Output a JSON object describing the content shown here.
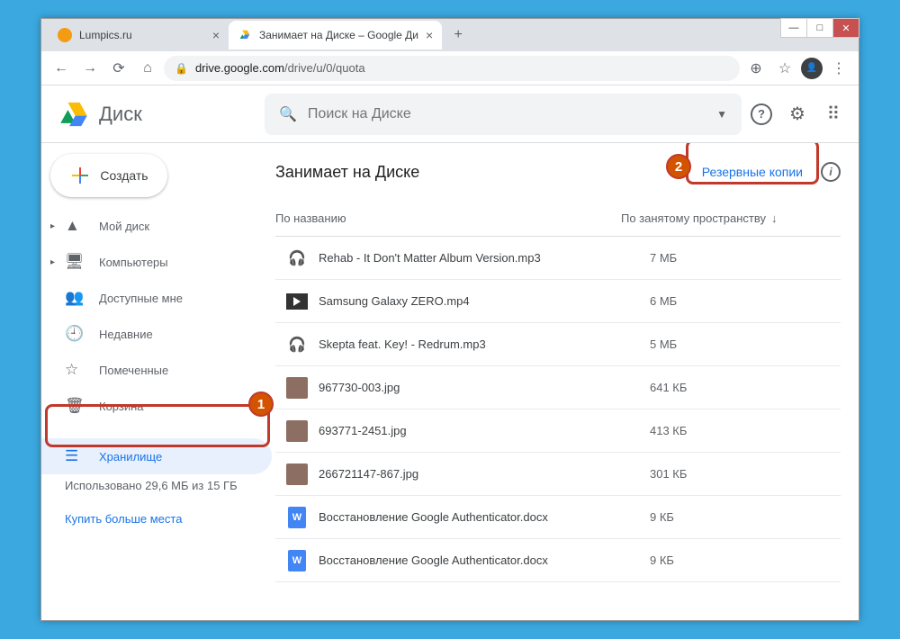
{
  "window": {
    "minimize": "—",
    "maximize": "□",
    "close": "✕"
  },
  "tabs": [
    {
      "title": "Lumpics.ru",
      "active": false,
      "favicon_color": "#f39c12"
    },
    {
      "title": "Занимает на Диске – Google Ди",
      "active": true,
      "favicon_color": "#0f9d58"
    }
  ],
  "newtab": "+",
  "nav": {
    "back": "←",
    "forward": "→",
    "reload": "⟳",
    "home": "⌂"
  },
  "address": {
    "lock": "🔒",
    "host": "drive.google.com",
    "path": "/drive/u/0/quota",
    "new_icon": "⊕",
    "star": "☆",
    "menu": "⋮"
  },
  "app": {
    "name": "Диск",
    "search_placeholder": "Поиск на Диске",
    "help": "?",
    "settings": "⚙",
    "apps": "⠿"
  },
  "create_label": "Создать",
  "sidebar": [
    {
      "icon": "▲",
      "label": "Мой диск",
      "expandable": true
    },
    {
      "icon": "🖥",
      "label": "Компьютеры",
      "expandable": true
    },
    {
      "icon": "👥",
      "label": "Доступные мне"
    },
    {
      "icon": "🕘",
      "label": "Недавние"
    },
    {
      "icon": "☆",
      "label": "Помеченные"
    },
    {
      "icon": "🗑",
      "label": "Корзина"
    }
  ],
  "storage_item": {
    "icon": "☰",
    "label": "Хранилище"
  },
  "storage_used": "Использовано 29,6 МБ из 15 ГБ",
  "buy_more": "Купить больше места",
  "page_title": "Занимает на Диске",
  "backups": "Резервные копии",
  "columns": {
    "name": "По названию",
    "size": "По занятому пространству",
    "arrow": "↓"
  },
  "files": [
    {
      "type": "audio",
      "name": "Rehab - It Don't Matter Album Version.mp3",
      "size": "7 МБ"
    },
    {
      "type": "video",
      "name": "Samsung Galaxy ZERO.mp4",
      "size": "6 МБ"
    },
    {
      "type": "audio",
      "name": "Skepta feat. Key! - Redrum.mp3",
      "size": "5 МБ"
    },
    {
      "type": "image",
      "name": "967730-003.jpg",
      "size": "641 КБ"
    },
    {
      "type": "image",
      "name": "693771-2451.jpg",
      "size": "413 КБ"
    },
    {
      "type": "image",
      "name": "266721147-867.jpg",
      "size": "301 КБ"
    },
    {
      "type": "doc",
      "name": "Восстановление Google Authenticator.docx",
      "size": "9 КБ"
    },
    {
      "type": "doc",
      "name": "Восстановление Google Authenticator.docx",
      "size": "9 КБ"
    }
  ],
  "badges": {
    "one": "1",
    "two": "2"
  }
}
